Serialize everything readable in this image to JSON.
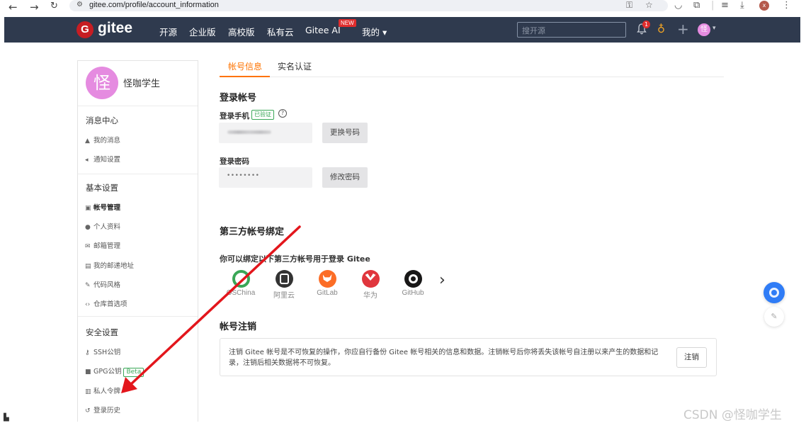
{
  "browser": {
    "url": "gitee.com/profile/account_information",
    "profile_initial": "x"
  },
  "navbar": {
    "logo_letter": "G",
    "logo_text": "gitee",
    "links": [
      "开源",
      "企业版",
      "高校版",
      "私有云",
      "Gitee AI",
      "我的 ▾"
    ],
    "new_badge": "NEW",
    "search_placeholder": "搜开源",
    "notification_count": "1",
    "avatar_initial": "怪"
  },
  "sidebar": {
    "avatar_initial": "怪",
    "username": "怪咖学生",
    "sections": [
      {
        "title": "消息中心",
        "items": [
          {
            "icon": "bell-icon",
            "label": "我的消息"
          },
          {
            "icon": "megaphone-icon",
            "label": "通知设置"
          }
        ]
      },
      {
        "title": "基本设置",
        "items": [
          {
            "icon": "id-card-icon",
            "label": "帐号管理",
            "active": true
          },
          {
            "icon": "user-icon",
            "label": "个人资料"
          },
          {
            "icon": "mail-icon",
            "label": "邮箱管理"
          },
          {
            "icon": "address-icon",
            "label": "我的邮递地址"
          },
          {
            "icon": "brush-icon",
            "label": "代码风格"
          },
          {
            "icon": "code-icon",
            "label": "仓库首选项"
          }
        ]
      },
      {
        "title": "安全设置",
        "items": [
          {
            "icon": "key-icon",
            "label": "SSH公钥"
          },
          {
            "icon": "lock-icon",
            "label": "GPG公钥",
            "badge": "Beta"
          },
          {
            "icon": "token-icon",
            "label": "私人令牌"
          },
          {
            "icon": "history-icon",
            "label": "登录历史"
          }
        ]
      }
    ]
  },
  "main": {
    "tabs": [
      "帐号信息",
      "实名认证"
    ],
    "login_account": {
      "title": "登录帐号",
      "phone_label": "登录手机",
      "verified_badge": "已验证",
      "help_icon": "?",
      "change_phone_button": "更换号码",
      "password_label": "登录密码",
      "password_value": "••••••••",
      "change_password_button": "修改密码"
    },
    "third_party": {
      "title": "第三方帐号绑定",
      "subtitle": "你可以绑定以下第三方帐号用于登录 Gitee",
      "providers": [
        {
          "name": "OSChina",
          "color": "#3aa757"
        },
        {
          "name": "阿里云",
          "color": "#333333"
        },
        {
          "name": "GitLab",
          "color": "#fc6d26"
        },
        {
          "name": "华为",
          "color": "#e0363d"
        },
        {
          "name": "GitHub",
          "color": "#181717"
        }
      ]
    },
    "deactivate": {
      "title": "帐号注销",
      "text": "注销 Gitee 帐号是不可恢复的操作，你应自行备份 Gitee 帐号相关的信息和数据。注销帐号后你将丢失该帐号自注册以来产生的数据和记录，注销后相关数据将不可恢复。",
      "button": "注销"
    }
  },
  "watermark": "CSDN @怪咖学生",
  "colors": {
    "accent": "#fe7300",
    "navbar_bg": "#2f3a4e",
    "annotation_arrow": "#e3161c"
  }
}
